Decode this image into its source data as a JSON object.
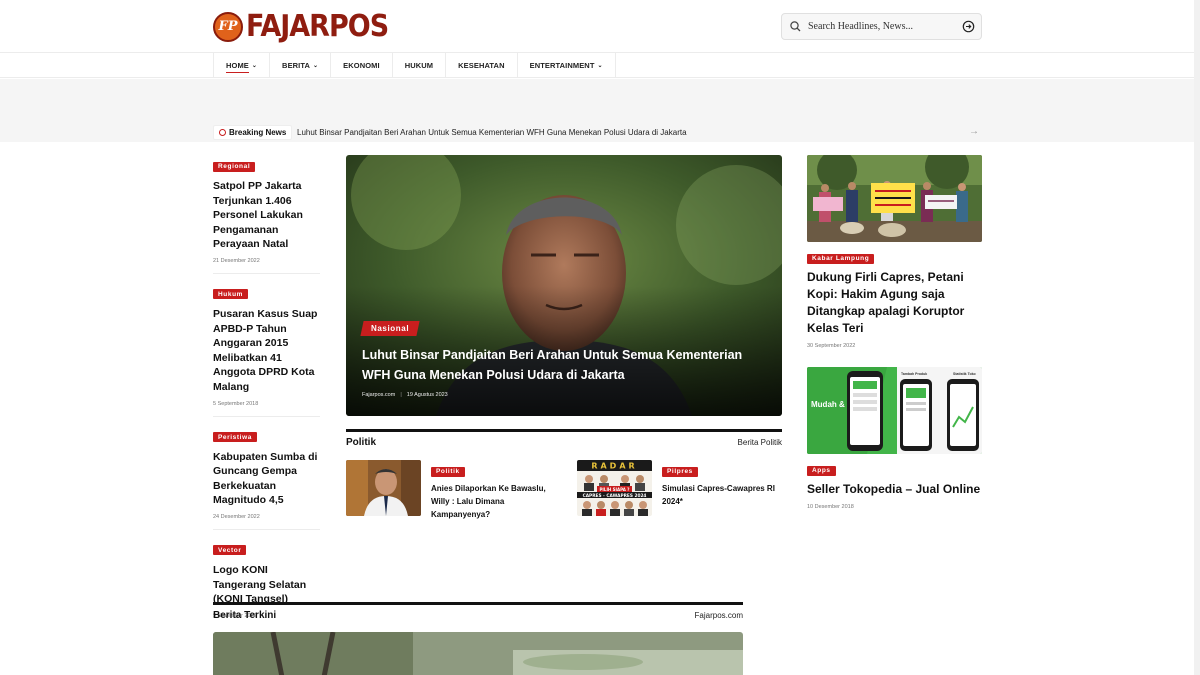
{
  "brand": {
    "badge": "FP",
    "name": "FAJARPOS"
  },
  "search": {
    "placeholder": "Search Headlines, News..."
  },
  "nav": [
    {
      "label": "HOME",
      "dropdown": true,
      "active": true
    },
    {
      "label": "BERITA",
      "dropdown": true,
      "active": false
    },
    {
      "label": "EKONOMI",
      "dropdown": false,
      "active": false
    },
    {
      "label": "HUKUM",
      "dropdown": false,
      "active": false
    },
    {
      "label": "KESEHATAN",
      "dropdown": false,
      "active": false
    },
    {
      "label": "ENTERTAINMENT",
      "dropdown": true,
      "active": false
    }
  ],
  "ticker": {
    "label": "Breaking News",
    "text": "Luhut Binsar Pandjaitan Beri Arahan Untuk Semua Kementerian WFH Guna Menekan Polusi Udara di Jakarta"
  },
  "left_column": [
    {
      "category": "Regional",
      "title": "Satpol PP Jakarta Terjunkan 1.406 Personel Lakukan Pengamanan Perayaan Natal",
      "date": "21 Desember 2022"
    },
    {
      "category": "Hukum",
      "title": "Pusaran Kasus Suap APBD-P Tahun Anggaran 2015 Melibatkan 41 Anggota DPRD Kota Malang",
      "date": "5 September 2018"
    },
    {
      "category": "Peristiwa",
      "title": "Kabupaten Sumba di Guncang Gempa Berkekuatan Magnitudo 4,5",
      "date": "24 Desember 2022"
    },
    {
      "category": "Vector",
      "title": "Logo KONI Tangerang Selatan (KONI Tangsel)",
      "date": "9 November 2022"
    }
  ],
  "hero": {
    "category": "Nasional",
    "title": "Luhut Binsar Pandjaitan Beri Arahan Untuk Semua Kementerian WFH Guna Menekan Polusi Udara di Jakarta",
    "author": "Fajarpos.com",
    "date": "19 Agustus 2023"
  },
  "politik": {
    "heading": "Politik",
    "link": "Berita Politik",
    "items": [
      {
        "category": "Politik",
        "title": "Anies Dilaporkan Ke Bawaslu, Willy : Lalu Dimana Kampanyenya?"
      },
      {
        "category": "Pilpres",
        "title": "Simulasi Capres-Cawapres RI 2024*",
        "thumb_text_top": "RADAR",
        "thumb_text_mid": "PILIH SIAPA ?",
        "thumb_text_bottom": "CAPRES - CAWAPRES 2024"
      }
    ]
  },
  "right_column": [
    {
      "category": "Kabar Lampung",
      "title": "Dukung Firli Capres, Petani Kopi: Hakim Agung saja Ditangkap apalagi Koruptor Kelas Teri",
      "date": "30 September 2022"
    },
    {
      "category": "Apps",
      "title": "Seller Tokopedia – Jual Online",
      "date": "10 Desember 2018",
      "thumb_text": "Mudah & Gratis",
      "thumb_col1": "Tambah Produk",
      "thumb_col2": "Statistik Toko"
    }
  ],
  "terkini": {
    "heading": "Berita Terkini",
    "link": "Fajarpos.com"
  },
  "colors": {
    "accent": "#c81e1e",
    "brand": "#8f1d10",
    "logo_badge": "#e0621b"
  },
  "icons": [
    "search-icon",
    "arrow-circle-icon",
    "chevron-down-icon",
    "clock-icon",
    "arrow-right-icon"
  ]
}
